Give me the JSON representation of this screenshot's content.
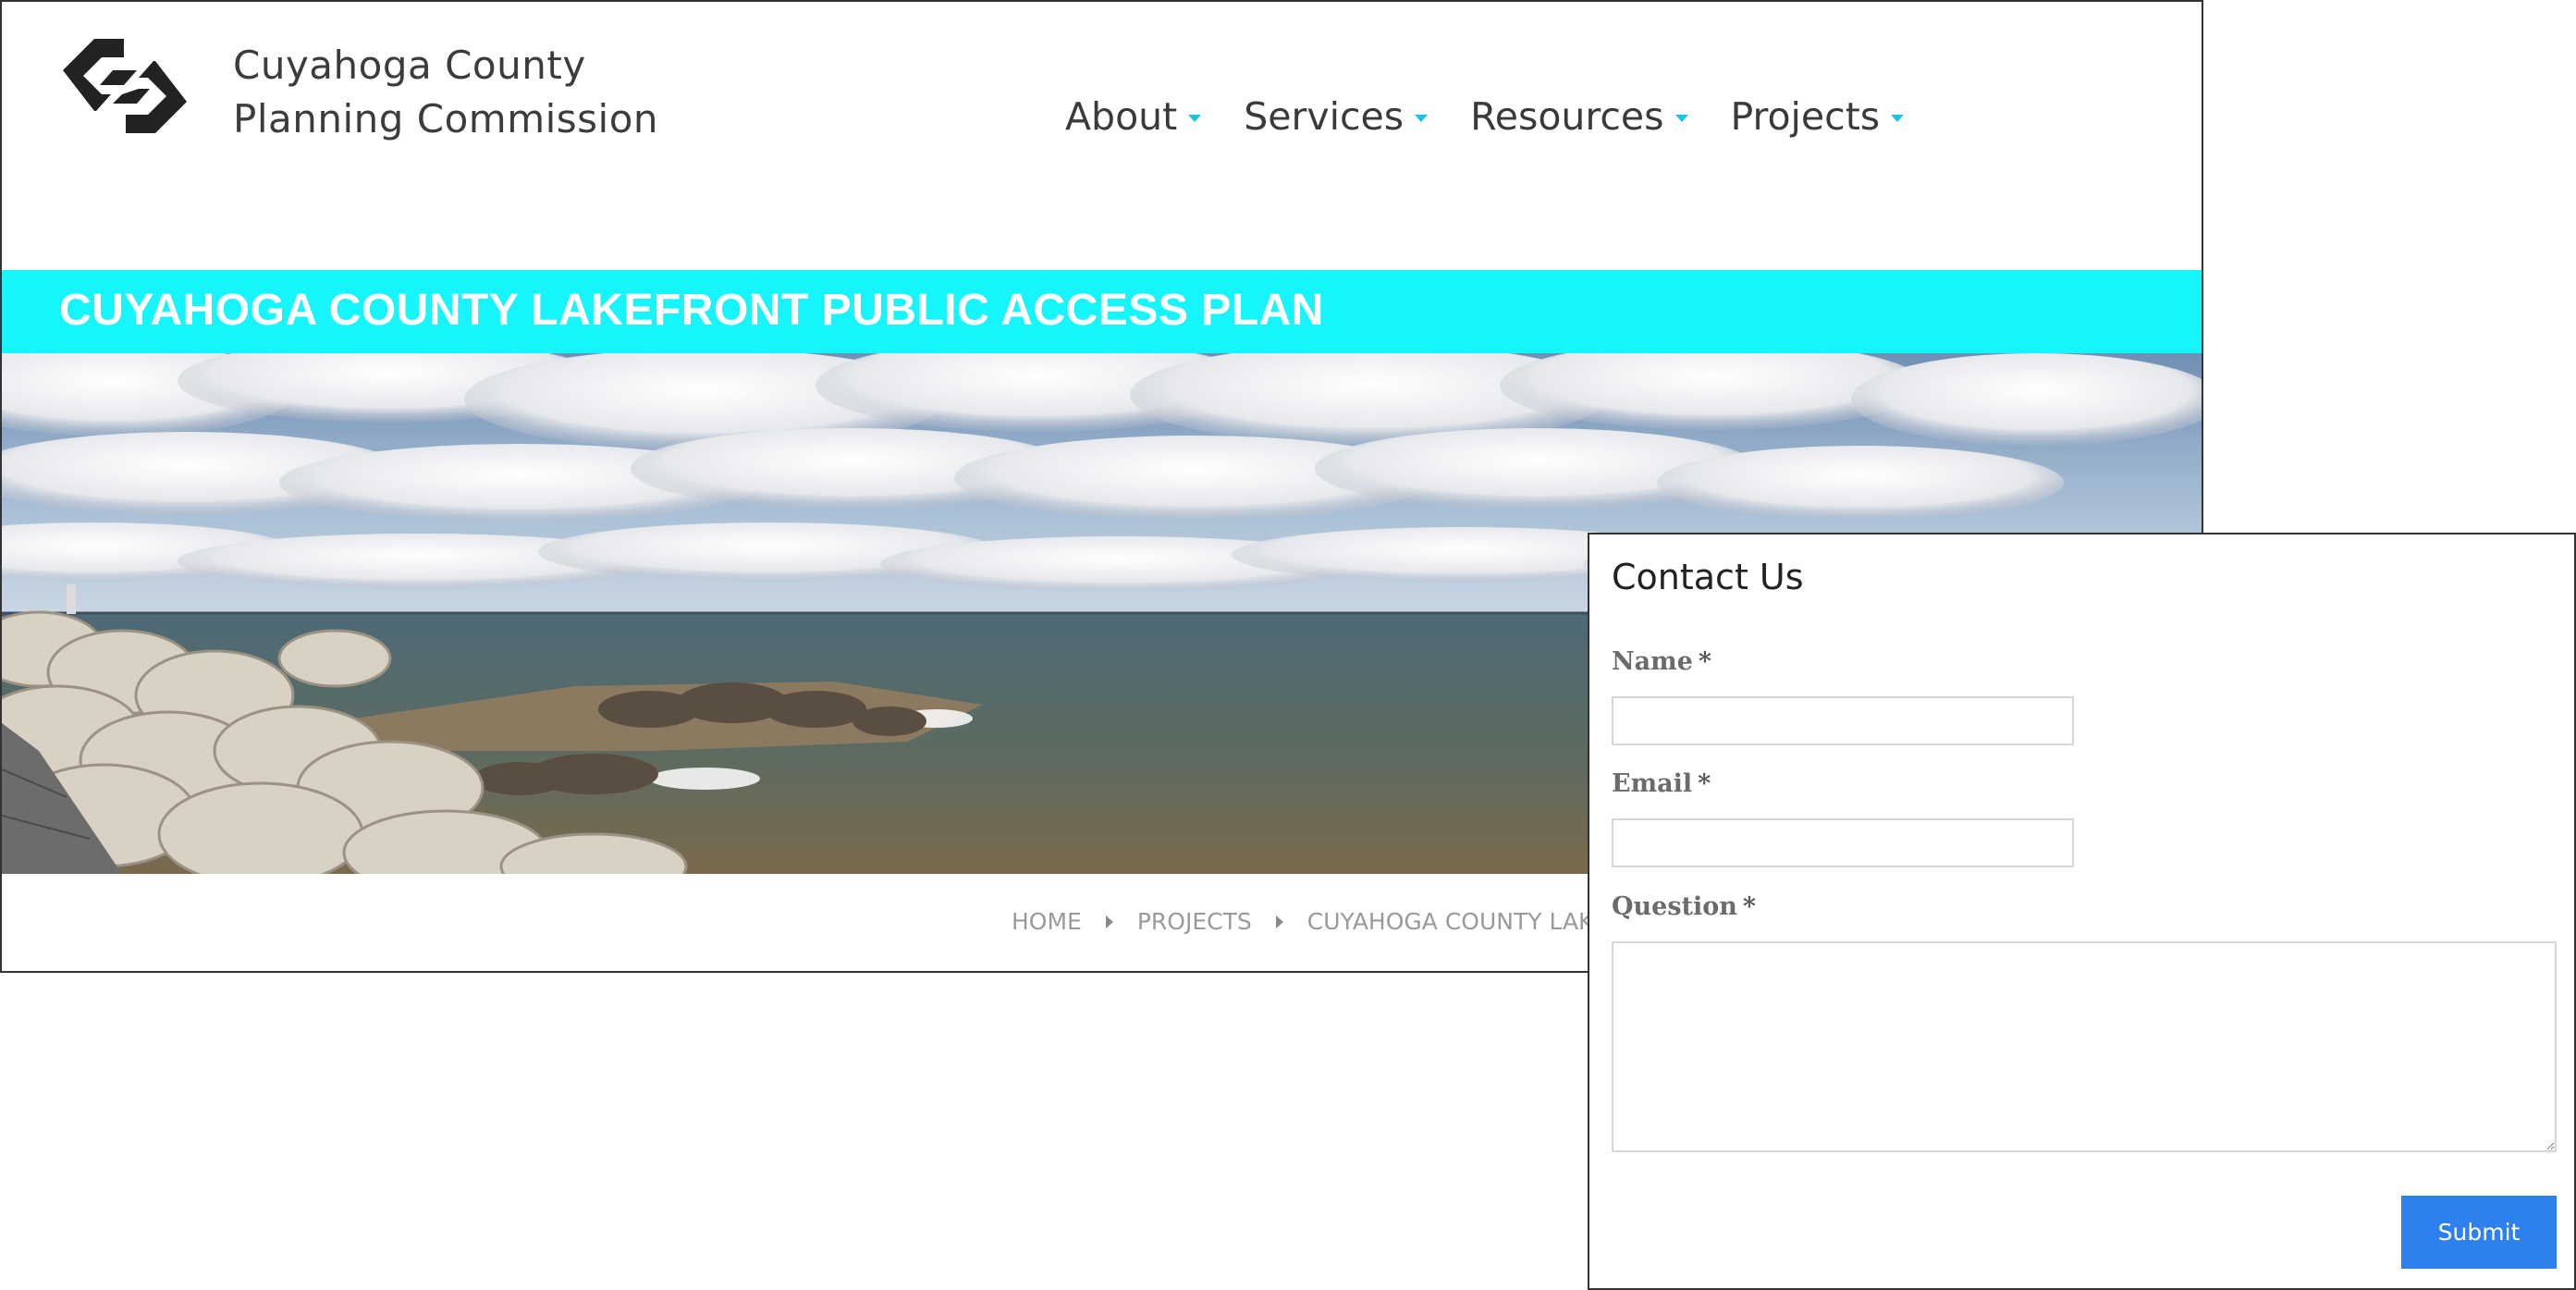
{
  "site": {
    "org_name_line1": "Cuyahoga County",
    "org_name_line2": "Planning Commission",
    "logo_icon": "cpc-chain-logo-icon",
    "nav": [
      {
        "label": "About"
      },
      {
        "label": "Services"
      },
      {
        "label": "Resources"
      },
      {
        "label": "Projects"
      }
    ],
    "page_title": "CUYAHOGA COUNTY LAKEFRONT PUBLIC ACCESS PLAN",
    "breadcrumb": {
      "home": "HOME",
      "projects": "PROJECTS",
      "current": "CUYAHOGA COUNTY LAKEFR"
    }
  },
  "contact": {
    "title": "Contact Us",
    "name_label": "Name",
    "email_label": "Email",
    "question_label": "Question",
    "required_mark": "*",
    "name_value": "",
    "email_value": "",
    "question_value": "",
    "submit_label": "Submit"
  },
  "colors": {
    "accent_cyan": "#15f5fb",
    "nav_caret": "#19c3e6",
    "submit_blue": "#2d80ee",
    "text_dark": "#3a3a3a"
  }
}
